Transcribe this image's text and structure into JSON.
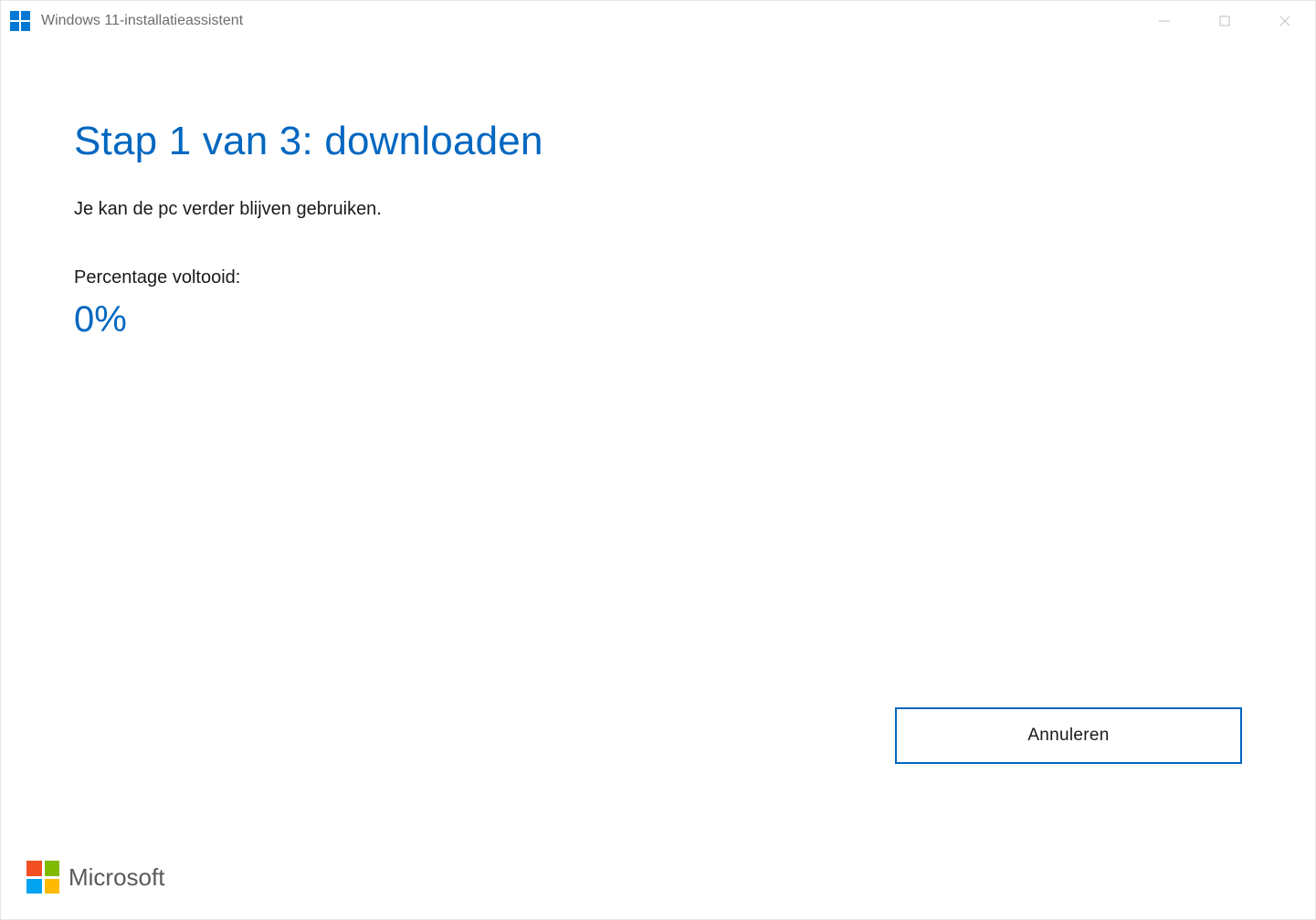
{
  "window": {
    "title": "Windows 11-installatieassistent"
  },
  "main": {
    "heading": "Stap 1 van 3: downloaden",
    "subtext": "Je kan de pc verder blijven gebruiken.",
    "percent_label": "Percentage voltooid:",
    "percent_value": "0%"
  },
  "actions": {
    "cancel_label": "Annuleren"
  },
  "footer": {
    "brand": "Microsoft"
  }
}
